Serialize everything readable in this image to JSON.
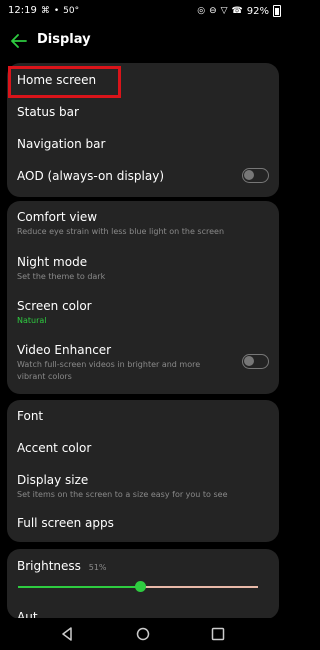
{
  "status_bar": {
    "time": "12:19",
    "left_icons": [
      "⌘",
      "•"
    ],
    "temperature": "50°",
    "right_icons": [
      "◎",
      "⊖",
      "▽",
      "☎"
    ],
    "battery": "92%"
  },
  "header": {
    "title": "Display",
    "back_icon": "arrow-left"
  },
  "groups": [
    {
      "items": [
        {
          "title": "Home screen"
        },
        {
          "title": "Status bar"
        },
        {
          "title": "Navigation bar"
        },
        {
          "title": "AOD (always-on display)",
          "toggle": false
        }
      ]
    },
    {
      "items": [
        {
          "title": "Comfort view",
          "subtitle": "Reduce eye strain with less blue light on the screen"
        },
        {
          "title": "Night mode",
          "subtitle": "Set the theme to dark"
        },
        {
          "title": "Screen color",
          "subtitle": "Natural"
        },
        {
          "title": "Video Enhancer",
          "subtitle": "Watch full-screen videos in brighter and more vibrant colors",
          "toggle": false
        }
      ]
    },
    {
      "items": [
        {
          "title": "Font"
        },
        {
          "title": "Accent color"
        },
        {
          "title": "Display size",
          "subtitle": "Set items on the screen to a size easy for you to see"
        },
        {
          "title": "Full screen apps"
        }
      ]
    },
    {
      "items": [
        {
          "title": "Brightness",
          "value_label": "51%"
        },
        {
          "title": "Aut"
        }
      ]
    }
  ],
  "brightness": {
    "value": 0.51
  },
  "colors": {
    "accent": "#2ecc40",
    "highlight": "#d9141a",
    "card": "#242424",
    "background": "#000000"
  },
  "nav": [
    "back-triangle",
    "home-circle",
    "recent-square"
  ]
}
